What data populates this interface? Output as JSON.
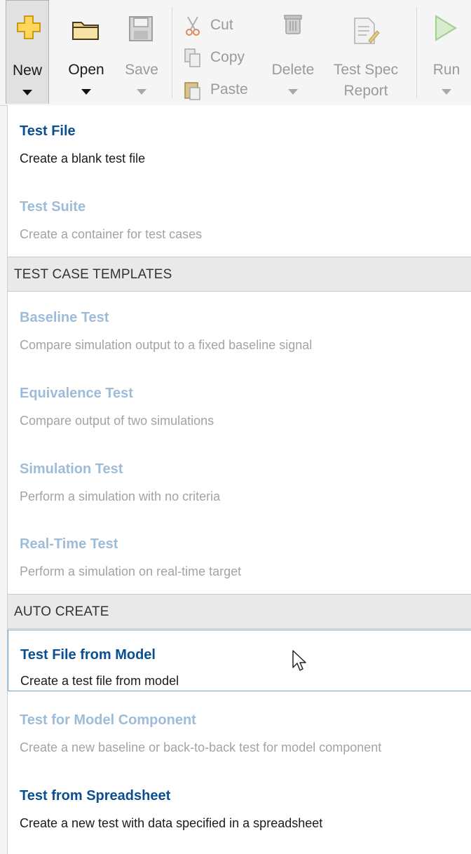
{
  "toolbar": {
    "new_label": "New",
    "open_label": "Open",
    "save_label": "Save",
    "cut_label": "Cut",
    "copy_label": "Copy",
    "paste_label": "Paste",
    "delete_label": "Delete",
    "report_label_1": "Test Spec",
    "report_label_2": "Report",
    "run_label": "Run"
  },
  "menu": {
    "items_top": [
      {
        "title": "Test File",
        "desc": "Create a blank test file"
      },
      {
        "title": "Test Suite",
        "desc": "Create a container for test cases"
      }
    ],
    "section_templates": "TEST CASE TEMPLATES",
    "templates": [
      {
        "title": "Baseline Test",
        "desc": "Compare simulation output to a fixed baseline signal"
      },
      {
        "title": "Equivalence Test",
        "desc": "Compare output of two simulations"
      },
      {
        "title": "Simulation Test",
        "desc": "Perform a simulation with no criteria"
      },
      {
        "title": "Real-Time Test",
        "desc": "Perform a simulation on real-time target"
      }
    ],
    "section_auto": "AUTO CREATE",
    "auto": [
      {
        "title": "Test File from Model",
        "desc": "Create a test file from model"
      },
      {
        "title": "Test for Model Component",
        "desc": "Create a new baseline or back-to-back test for model component"
      },
      {
        "title": "Test from Spreadsheet",
        "desc": "Create a new test with data specified in a spreadsheet"
      }
    ]
  },
  "colors": {
    "link_blue": "#0a4f91",
    "disabled_blue": "#9dbcd9",
    "hover_border": "#6aa5d6"
  }
}
